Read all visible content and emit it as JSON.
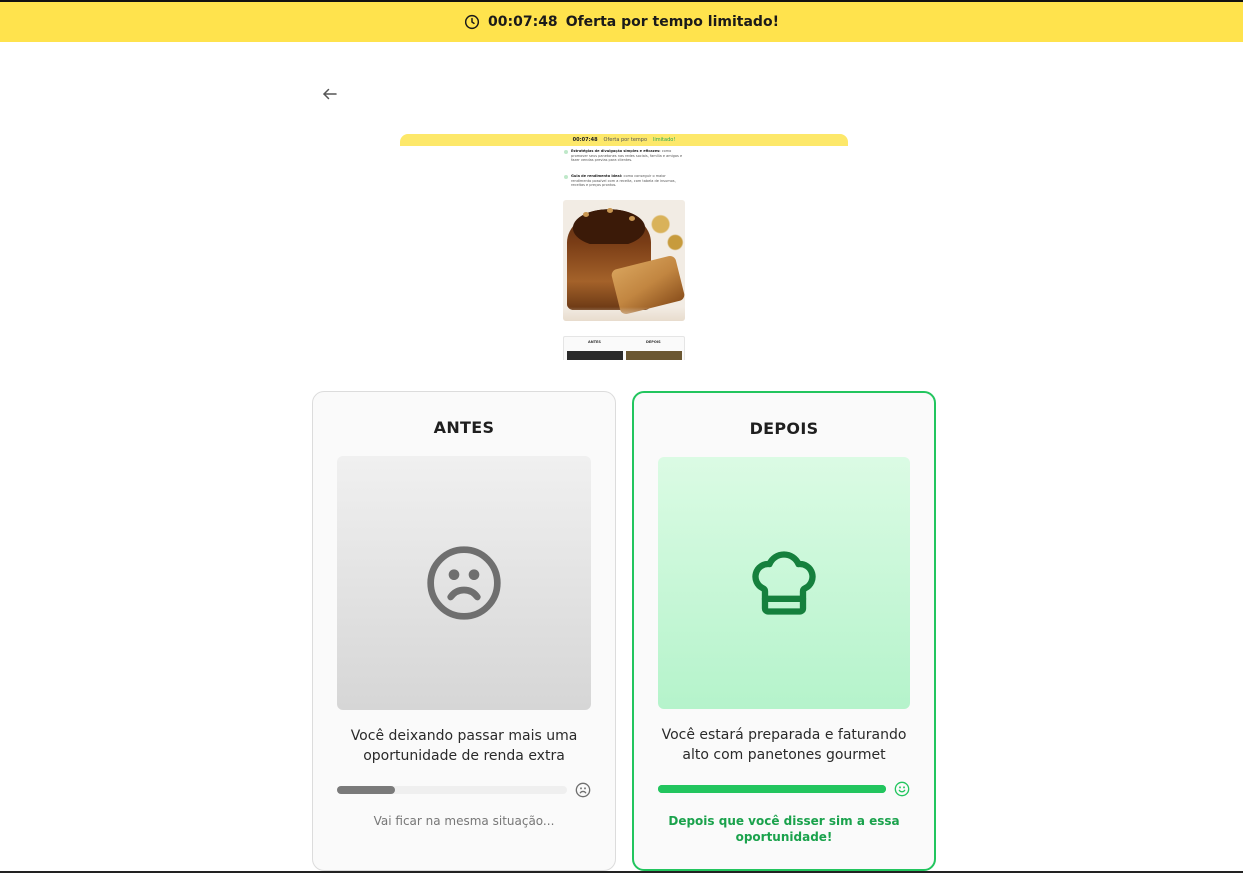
{
  "banner": {
    "timer": "00:07:48",
    "offer_text": "Oferta por tempo limitado!",
    "bg_color": "#ffe34d"
  },
  "nav": {
    "back_icon": "arrow-left-icon"
  },
  "preview": {
    "banner_timer": "00:07:48",
    "banner_text": "Oferta por tempo",
    "banner_highlight": "limitado!",
    "item1_bold": "Estratégias de divulgação simples e eficazes:",
    "item1_text": "como promover seus panetones nas redes sociais, família e amigos e fazer vendas previas para clientes.",
    "item2_bold": "Guia de rendimento ideal:",
    "item2_text": "como conseguir o maior rendimento possível com a receita, com tabela de insumos, receitas e preços prontos.",
    "table_left": "ANTES",
    "table_right": "DEPOIS"
  },
  "cards": {
    "antes": {
      "title": "ANTES",
      "icon": "sad-face-icon",
      "description": "Você deixando passar mais uma oportunidade de renda extra",
      "progress": 0.25,
      "bar_icon": "sad-face-small-icon",
      "footer": "Vai ficar na mesma situação..."
    },
    "depois": {
      "title": "DEPOIS",
      "icon": "chef-hat-icon",
      "description": "Você estará preparada e faturando alto com panetones gourmet",
      "progress": 1.0,
      "bar_icon": "happy-face-small-icon",
      "footer": "Depois que você disser sim a essa oportunidade!"
    }
  },
  "colors": {
    "accent_green": "#22c55e",
    "footer_green": "#1aa24c",
    "neutral_bar": "#7a7a7a"
  }
}
